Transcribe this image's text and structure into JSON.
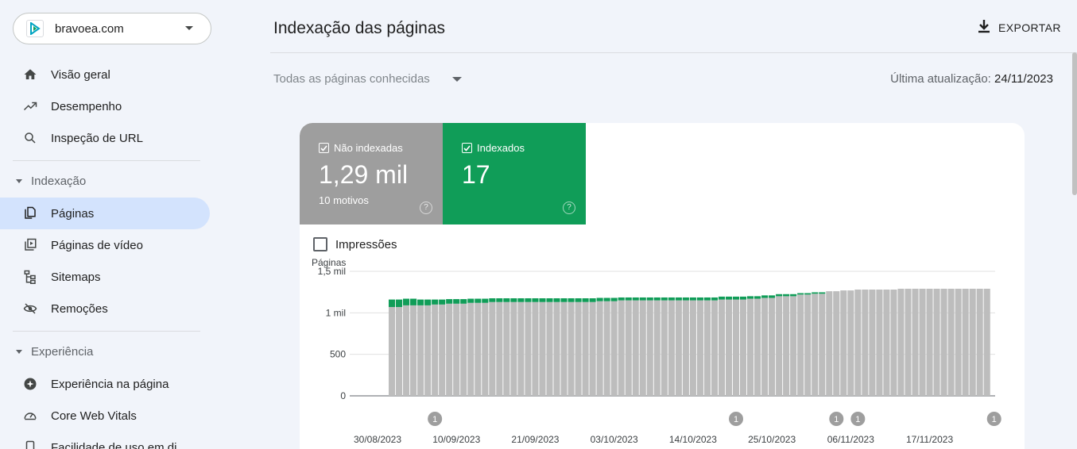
{
  "property": {
    "name": "bravoea.com"
  },
  "nav": {
    "overview": "Visão geral",
    "performance": "Desempenho",
    "url_inspection": "Inspeção de URL",
    "section_indexing": "Indexação",
    "pages": "Páginas",
    "video_pages": "Páginas de vídeo",
    "sitemaps": "Sitemaps",
    "removals": "Remoções",
    "section_experience": "Experiência",
    "page_experience": "Experiência na página",
    "cwv": "Core Web Vitals",
    "mobile": "Facilidade de uso em di"
  },
  "header": {
    "title": "Indexação das páginas",
    "export": "EXPORTAR",
    "filter": "Todas as páginas conhecidas",
    "updated_label": "Última atualização:",
    "updated_value": "24/11/2023"
  },
  "tiles": {
    "not_indexed": {
      "label": "Não indexadas",
      "value": "1,29 mil",
      "sub": "10 motivos"
    },
    "indexed": {
      "label": "Indexados",
      "value": "17"
    }
  },
  "impressions_label": "Impressões",
  "colors": {
    "not_indexed": "#bdbdbd",
    "indexed": "#109d58",
    "active_nav": "#d3e3fd"
  },
  "chart_data": {
    "type": "bar",
    "stacked": true,
    "ylabel": "Páginas",
    "yticks": [
      "0",
      "500",
      "1 mil",
      "1,5 mil"
    ],
    "ylim": [
      0,
      1500
    ],
    "x_tick_labels": [
      "30/08/2023",
      "10/09/2023",
      "21/09/2023",
      "03/10/2023",
      "14/10/2023",
      "25/10/2023",
      "06/11/2023",
      "17/11/2023"
    ],
    "annotation_label": "1",
    "annotation_days": [
      6,
      48,
      62,
      65,
      84
    ],
    "first_day": "2023-09-01",
    "series": [
      {
        "name": "Não indexadas",
        "values": [
          1070,
          1070,
          1090,
          1090,
          1090,
          1090,
          1100,
          1100,
          1110,
          1110,
          1110,
          1120,
          1120,
          1120,
          1130,
          1130,
          1130,
          1130,
          1130,
          1130,
          1130,
          1130,
          1130,
          1130,
          1130,
          1130,
          1130,
          1130,
          1130,
          1140,
          1140,
          1140,
          1150,
          1150,
          1150,
          1150,
          1150,
          1150,
          1150,
          1150,
          1150,
          1150,
          1150,
          1150,
          1150,
          1150,
          1160,
          1160,
          1160,
          1160,
          1170,
          1170,
          1180,
          1180,
          1200,
          1200,
          1200,
          1220,
          1220,
          1230,
          1230,
          1260,
          1260,
          1270,
          1270,
          1280,
          1280,
          1280,
          1280,
          1280,
          1280,
          1290,
          1290,
          1290,
          1290,
          1290,
          1290,
          1290,
          1290,
          1290,
          1290,
          1290,
          1290,
          1290
        ]
      },
      {
        "name": "Indexados",
        "values": [
          90,
          90,
          80,
          80,
          70,
          70,
          60,
          60,
          55,
          55,
          55,
          50,
          50,
          50,
          45,
          45,
          45,
          45,
          45,
          45,
          45,
          45,
          45,
          45,
          45,
          45,
          45,
          45,
          45,
          40,
          40,
          40,
          35,
          35,
          35,
          35,
          35,
          35,
          35,
          35,
          35,
          35,
          35,
          35,
          35,
          35,
          35,
          35,
          35,
          35,
          30,
          30,
          30,
          30,
          25,
          25,
          25,
          17,
          17,
          17,
          17,
          0,
          0,
          0,
          0,
          0,
          0,
          0,
          0,
          0,
          0,
          0,
          0,
          0,
          0,
          0,
          0,
          0,
          0,
          0,
          0,
          0,
          0,
          0
        ]
      }
    ]
  }
}
